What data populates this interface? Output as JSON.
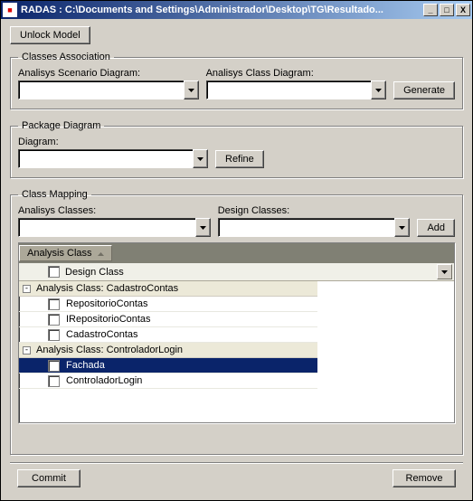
{
  "title": "RADAS : C:\\Documents and Settings\\Administrador\\Desktop\\TG\\Resultado...",
  "app_icon_glyph": "■",
  "buttons": {
    "unlock": "Unlock Model",
    "generate": "Generate",
    "refine": "Refine",
    "add": "Add",
    "commit": "Commit",
    "remove": "Remove"
  },
  "win_btns": {
    "min": "_",
    "max": "□",
    "close": "X"
  },
  "groups": {
    "classes_assoc": "Classes Association",
    "package_diagram": "Package Diagram",
    "class_mapping": "Class Mapping"
  },
  "labels": {
    "scenario": "Analisys Scenario Diagram:",
    "class_diagram": "Analisys Class Diagram:",
    "pkg_diagram": "Diagram:",
    "analysis_classes": "Analisys Classes:",
    "design_classes": "Design Classes:"
  },
  "grid": {
    "band": "Analysis Class",
    "header": "Design Class",
    "groups": [
      {
        "label": "Analysis Class:  CadastroContas",
        "items": [
          {
            "name": "RepositorioContas",
            "selected": false
          },
          {
            "name": "IRepositorioContas",
            "selected": false
          },
          {
            "name": "CadastroContas",
            "selected": false
          }
        ]
      },
      {
        "label": "Analysis Class:  ControladorLogin",
        "items": [
          {
            "name": "Fachada",
            "selected": true
          },
          {
            "name": "ControladorLogin",
            "selected": false
          }
        ]
      }
    ]
  }
}
